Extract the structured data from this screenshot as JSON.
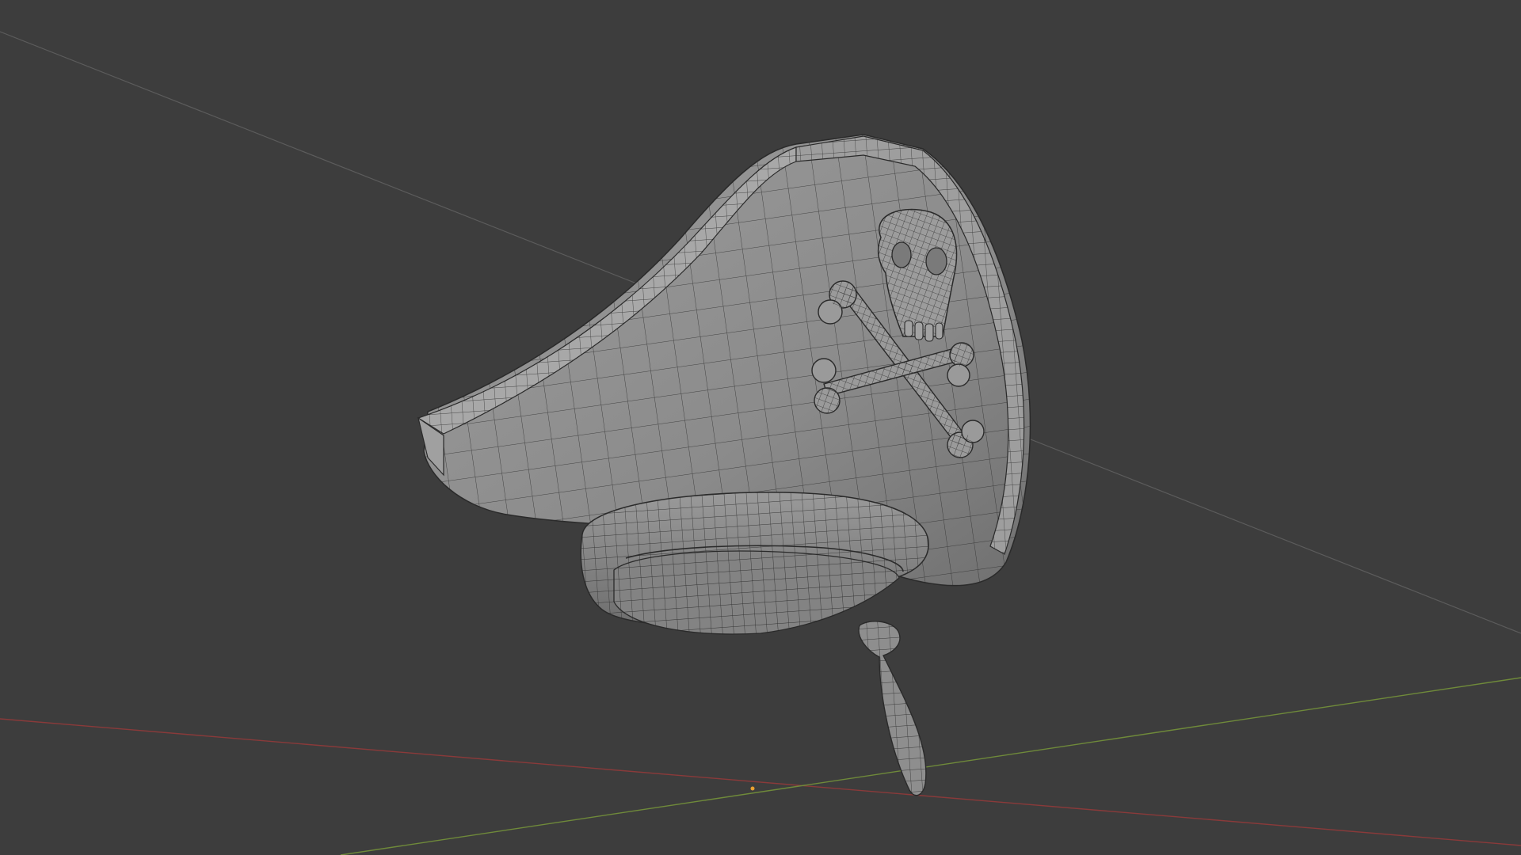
{
  "viewport": {
    "background": "#3d3d3d",
    "axis_x_color": "#8a3a3a",
    "axis_y_color": "#6f8a3a",
    "helper_line_color": "#6a6a6a",
    "origin_color": "#e8a030",
    "mesh_fill": "#8f8f8f",
    "mesh_wire": "#2a2a2a",
    "shading": "solid",
    "overlay": "wireframe"
  },
  "model": {
    "icon": "pirate-hat-icon",
    "emblem": "skull-and-crossbones-icon"
  }
}
